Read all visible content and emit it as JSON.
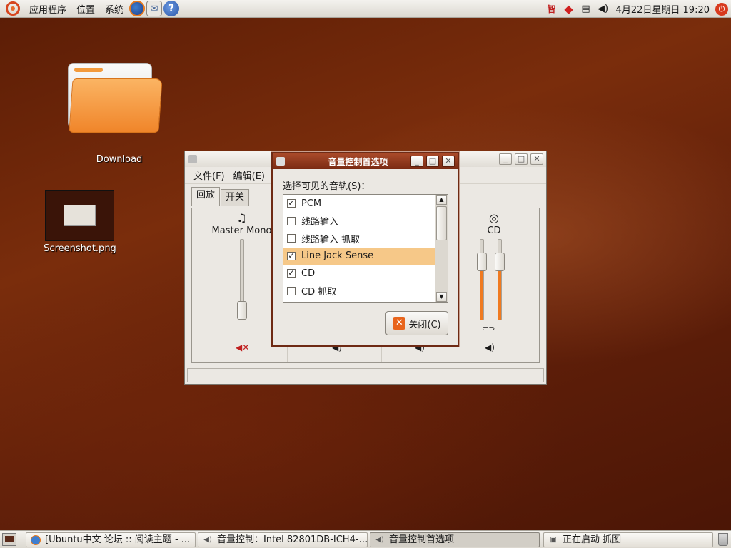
{
  "top_panel": {
    "menus": [
      "应用程序",
      "位置",
      "系统"
    ],
    "clock": "4月22日星期日 19:20",
    "tray_text": "智"
  },
  "desktop": {
    "icons": [
      {
        "label": "Download"
      },
      {
        "label": "Screenshot.png"
      }
    ]
  },
  "main_window": {
    "title": "音量控制：Intel 82801DB-ICH4",
    "menu": [
      "文件(F)",
      "编辑(E)"
    ],
    "tabs": [
      "回放",
      "开关"
    ],
    "tracks": [
      {
        "label": "Master Mono",
        "level": 0.25,
        "muted": true
      },
      {
        "label": "CD",
        "left_level": 0.7,
        "right_level": 0.7
      }
    ]
  },
  "dialog": {
    "title": "音量控制首选项",
    "prompt": "选择可见的音轨(S)：",
    "items": [
      {
        "label": "PCM",
        "checked": true
      },
      {
        "label": "线路输入",
        "checked": false
      },
      {
        "label": "线路输入 抓取",
        "checked": false
      },
      {
        "label": "Line Jack Sense",
        "checked": true,
        "selected": true
      },
      {
        "label": "CD",
        "checked": true
      },
      {
        "label": "CD 抓取",
        "checked": false
      }
    ],
    "close_label": "关闭(C)"
  },
  "taskbar": {
    "tasks": [
      {
        "label": "[Ubuntu中文 论坛 :: 阅读主题 - ...",
        "active": false
      },
      {
        "label": "音量控制：Intel 82801DB-ICH4-…",
        "active": false
      },
      {
        "label": "音量控制首选项",
        "active": true
      },
      {
        "label": "正在启动 抓图",
        "active": false
      }
    ]
  },
  "colors": {
    "accent": "#f07a20",
    "selection": "#f6c888",
    "dialog_title": "#8a3418"
  }
}
